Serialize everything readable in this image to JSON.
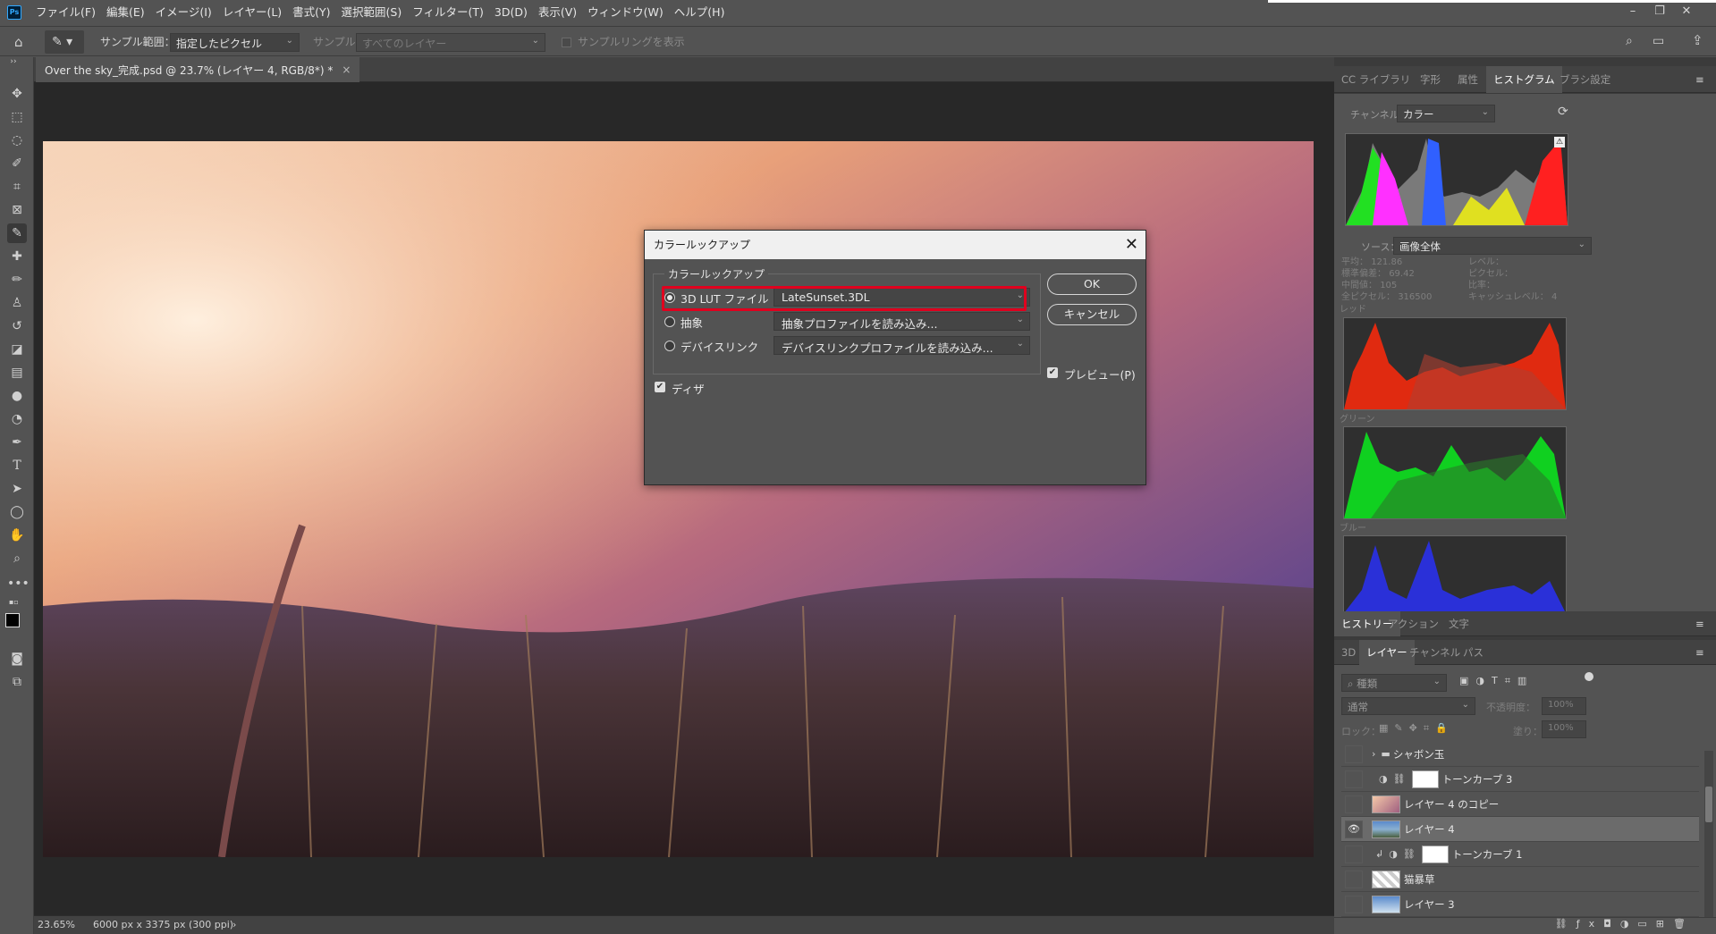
{
  "app": {
    "logo_text": "Ps"
  },
  "menu": [
    "ファイル(F)",
    "編集(E)",
    "イメージ(I)",
    "レイヤー(L)",
    "書式(Y)",
    "選択範囲(S)",
    "フィルター(T)",
    "3D(D)",
    "表示(V)",
    "ウィンドウ(W)",
    "ヘルプ(H)"
  ],
  "options": {
    "sample_size_label": "サンプル範囲：",
    "sample_size_value": "指定したピクセル",
    "sample_label": "サンプル：",
    "sample_value": "すべてのレイヤー",
    "show_ring_label": "サンプルリングを表示"
  },
  "document": {
    "tab_title": "Over the sky_完成.psd @ 23.7% (レイヤー 4, RGB/8*) *",
    "zoom": "23.65%",
    "size_info": "6000 px x 3375 px (300 ppi)"
  },
  "dialog": {
    "title": "カラールックアップ",
    "group_label": "カラールックアップ",
    "options": [
      {
        "label": "3D LUT ファイル",
        "value": "LateSunset.3DL",
        "selected": true
      },
      {
        "label": "抽象",
        "value": "抽象プロファイルを読み込み...",
        "selected": false
      },
      {
        "label": "デバイスリンク",
        "value": "デバイスリンクプロファイルを読み込み...",
        "selected": false
      }
    ],
    "dither_label": "ディザ",
    "ok_label": "OK",
    "cancel_label": "キャンセル",
    "preview_label": "プレビュー(P)",
    "highlight_color": "#e0001e"
  },
  "top_panel": {
    "tabs": [
      "CC ライブラリ",
      "字形",
      "属性",
      "ヒストグラム",
      "ブラシ設定"
    ],
    "active_tab": "ヒストグラム"
  },
  "histogram": {
    "channel_label": "チャンネル：",
    "channel_value": "カラー",
    "source_label": "ソース：",
    "source_value": "画像全体",
    "stats_left": [
      {
        "label": "平均：",
        "value": "121.86"
      },
      {
        "label": "標準偏差：",
        "value": "69.42"
      },
      {
        "label": "中間値：",
        "value": "105"
      },
      {
        "label": "全ピクセル：",
        "value": "316500"
      }
    ],
    "stats_right": [
      {
        "label": "レベル：",
        "value": ""
      },
      {
        "label": "ピクセル：",
        "value": ""
      },
      {
        "label": "比率：",
        "value": ""
      },
      {
        "label": "キャッシュレベル：",
        "value": "4"
      }
    ],
    "red_label": "レッド",
    "green_label": "グリーン",
    "blue_label": "ブルー"
  },
  "history_panel": {
    "tabs": [
      "ヒストリー",
      "アクション",
      "文字"
    ],
    "active_tab": "ヒストリー"
  },
  "layers_panel": {
    "tabs": [
      "3D",
      "レイヤー",
      "チャンネル",
      "パス"
    ],
    "active_tab": "レイヤー",
    "filter_placeholder": "種類",
    "blend_mode": "通常",
    "opacity_label": "不透明度：",
    "opacity_value": "100%",
    "lock_label": "ロック：",
    "fill_label": "塗り：",
    "fill_value": "100%",
    "layers": [
      {
        "name": "シャボン玉",
        "kind": "group",
        "visible": false,
        "selected": false
      },
      {
        "name": "トーンカーブ 3",
        "kind": "adjustment",
        "visible": false,
        "selected": false
      },
      {
        "name": "レイヤー 4 のコピー",
        "kind": "pixel",
        "visible": false,
        "selected": false
      },
      {
        "name": "レイヤー 4",
        "kind": "pixel",
        "visible": true,
        "selected": true
      },
      {
        "name": "トーンカーブ 1",
        "kind": "adjustment",
        "visible": false,
        "selected": false
      },
      {
        "name": "猫暴草",
        "kind": "pixel",
        "visible": false,
        "selected": false
      },
      {
        "name": "レイヤー 3",
        "kind": "pixel",
        "visible": false,
        "selected": false
      }
    ]
  }
}
